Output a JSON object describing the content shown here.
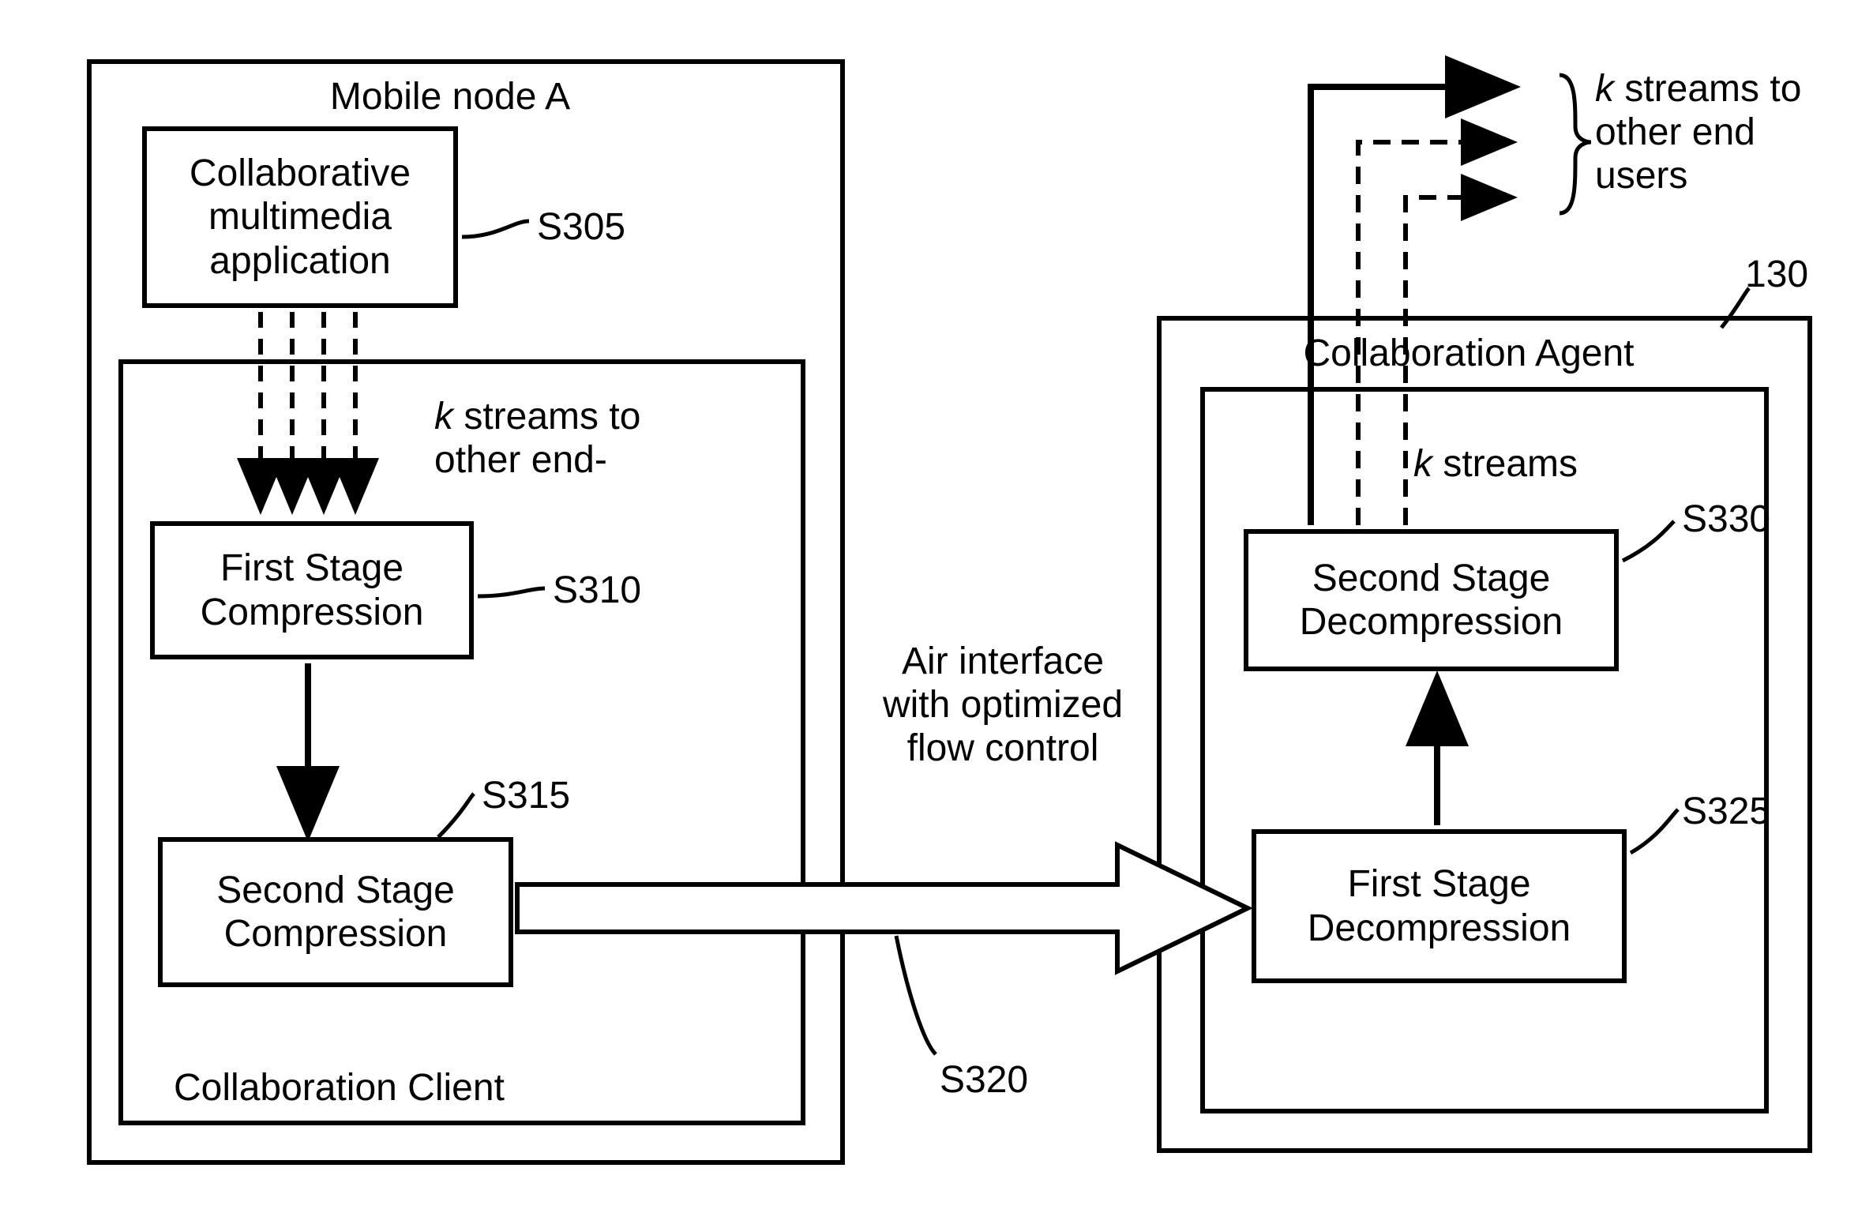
{
  "left_outer_title": "Mobile node A",
  "left_inner_title": "Collaboration Client",
  "app_box": "Collaborative\nmultimedia\napplication",
  "app_box_ref": "S305",
  "left_streams_note_prefix_italic": "k",
  "left_streams_note_rest": " streams to\nother end-",
  "first_comp_box": "First Stage\nCompression",
  "first_comp_ref": "S310",
  "second_comp_box": "Second Stage\nCompression",
  "second_comp_ref": "S315",
  "air_interface": "Air interface\nwith optimized\nflow control",
  "air_interface_ref": "S320",
  "right_outer_title": "Collaboration Agent",
  "right_outer_ref": "130",
  "right_streams_prefix_italic": "k",
  "right_streams_rest": " streams",
  "first_decomp_box": "First Stage\nDecompression",
  "first_decomp_ref": "S325",
  "second_decomp_box": "Second Stage\nDecompression",
  "second_decomp_ref": "S330",
  "top_right_note_prefix_italic": "k",
  "top_right_note_rest": " streams to\nother end\nusers"
}
